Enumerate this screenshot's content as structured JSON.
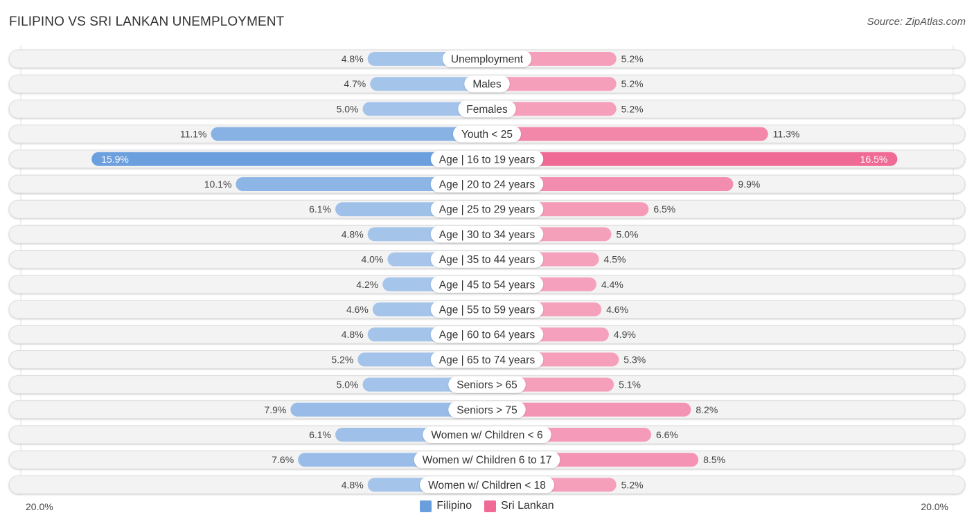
{
  "header": {
    "title": "FILIPINO VS SRI LANKAN UNEMPLOYMENT",
    "source": "Source: ZipAtlas.com"
  },
  "axis": {
    "left_label": "20.0%",
    "right_label": "20.0%"
  },
  "legend": [
    {
      "name": "Filipino",
      "color": "#6a9fde"
    },
    {
      "name": "Sri Lankan",
      "color": "#f06a96"
    }
  ],
  "chart_data": {
    "type": "bar",
    "orientation": "horizontal-diverging",
    "title": "FILIPINO VS SRI LANKAN UNEMPLOYMENT",
    "xlim": [
      -20,
      20
    ],
    "unit": "%",
    "categories": [
      "Unemployment",
      "Males",
      "Females",
      "Youth < 25",
      "Age | 16 to 19 years",
      "Age | 20 to 24 years",
      "Age | 25 to 29 years",
      "Age | 30 to 34 years",
      "Age | 35 to 44 years",
      "Age | 45 to 54 years",
      "Age | 55 to 59 years",
      "Age | 60 to 64 years",
      "Age | 65 to 74 years",
      "Seniors > 65",
      "Seniors > 75",
      "Women w/ Children < 6",
      "Women w/ Children 6 to 17",
      "Women w/ Children < 18"
    ],
    "series": [
      {
        "name": "Filipino",
        "side": "left",
        "values": [
          4.8,
          4.7,
          5.0,
          11.1,
          15.9,
          10.1,
          6.1,
          4.8,
          4.0,
          4.2,
          4.6,
          4.8,
          5.2,
          5.0,
          7.9,
          6.1,
          7.6,
          4.8
        ],
        "labels": [
          "4.8%",
          "4.7%",
          "5.0%",
          "11.1%",
          "15.9%",
          "10.1%",
          "6.1%",
          "4.8%",
          "4.0%",
          "4.2%",
          "4.6%",
          "4.8%",
          "5.2%",
          "5.0%",
          "7.9%",
          "6.1%",
          "7.6%",
          "4.8%"
        ]
      },
      {
        "name": "Sri Lankan",
        "side": "right",
        "values": [
          5.2,
          5.2,
          5.2,
          11.3,
          16.5,
          9.9,
          6.5,
          5.0,
          4.5,
          4.4,
          4.6,
          4.9,
          5.3,
          5.1,
          8.2,
          6.6,
          8.5,
          5.2
        ],
        "labels": [
          "5.2%",
          "5.2%",
          "5.2%",
          "11.3%",
          "16.5%",
          "9.9%",
          "6.5%",
          "5.0%",
          "4.5%",
          "4.4%",
          "4.6%",
          "4.9%",
          "5.3%",
          "5.1%",
          "8.2%",
          "6.6%",
          "8.5%",
          "5.2%"
        ]
      }
    ],
    "legend_position": "bottom-center",
    "grid": false
  }
}
